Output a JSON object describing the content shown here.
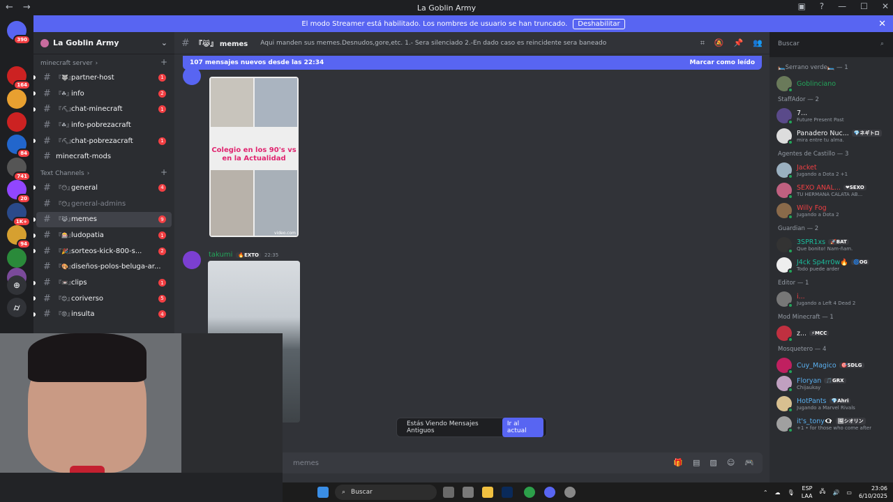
{
  "window": {
    "title": "La Goblin Army"
  },
  "servers": [
    {
      "badge": "390",
      "color": "#5865f2"
    },
    {
      "badge": "164",
      "color": "#c22"
    },
    {
      "badge": "",
      "color": "#e8a030"
    },
    {
      "badge": "",
      "color": "#c22"
    },
    {
      "badge": "84",
      "color": "#2266cc"
    },
    {
      "badge": "741",
      "color": "#555"
    },
    {
      "badge": "20",
      "color": "#9146ff"
    },
    {
      "badge": "1K+",
      "color": "#2a4a8a"
    },
    {
      "badge": "94",
      "color": "#d6a030"
    },
    {
      "badge": "",
      "color": "#2a8a3a"
    },
    {
      "badge": "",
      "color": "#7a4a9a"
    }
  ],
  "banner": {
    "text": "El modo Streamer está habilitado. Los nombres de usuario se han truncado.",
    "button": "Deshabilitar"
  },
  "guild": {
    "name": "La Goblin Army"
  },
  "categories": [
    {
      "label": "minecraft server",
      "channels": [
        {
          "name": "partner-host",
          "emoji": "『🐺』",
          "badge": "1",
          "muted": false
        },
        {
          "name": "info",
          "emoji": "『☘』",
          "badge": "2",
          "muted": false
        },
        {
          "name": "chat-minecraft",
          "emoji": "『⛏』",
          "badge": "1",
          "muted": false
        },
        {
          "name": "info-pobrezacraft",
          "emoji": "『☘』",
          "badge": "",
          "muted": false
        },
        {
          "name": "chat-pobrezacraft",
          "emoji": "『⛏』",
          "badge": "1",
          "muted": false
        },
        {
          "name": "minecraft-mods",
          "emoji": "",
          "badge": "",
          "muted": false
        }
      ]
    },
    {
      "label": "Text Channels",
      "channels": [
        {
          "name": "general",
          "emoji": "『😶』",
          "badge": "4",
          "muted": false
        },
        {
          "name": "general-admins",
          "emoji": "『😶』",
          "badge": "",
          "muted": true
        },
        {
          "name": "memes",
          "emoji": "『😹』",
          "badge": "9",
          "muted": false,
          "active": true
        },
        {
          "name": "ludopatia",
          "emoji": "『🎰』",
          "badge": "1",
          "muted": false
        },
        {
          "name": "sorteos-kick-800-s...",
          "emoji": "『🎉』",
          "badge": "2",
          "muted": false
        },
        {
          "name": "diseños-polos-beluga-ar...",
          "emoji": "『🎨』",
          "badge": "",
          "muted": false
        },
        {
          "name": "clips",
          "emoji": "『📼』",
          "badge": "1",
          "muted": false
        },
        {
          "name": "coriverso",
          "emoji": "『😊』",
          "badge": "5",
          "muted": false
        },
        {
          "name": "insulta",
          "emoji": "『😡』",
          "badge": "4",
          "muted": false
        }
      ]
    }
  ],
  "channel": {
    "name": "memes",
    "emoji": "『😹』",
    "topic": "Aqui manden sus memes.Desnudos,gore,etc. 1.- Sera silenciado 2.-En dado caso es reincidente sera baneado"
  },
  "new_messages": {
    "text": "107 mensajes nuevos desde las 22:34",
    "mark": "Marcar como leído"
  },
  "messages": [
    {
      "image_caption": "Colegio en los 90's vs en la Actualidad",
      "watermark": "video.com"
    },
    {
      "author": "takumi",
      "tag": "🔥EXTO",
      "time": "22:35"
    }
  ],
  "old_messages": {
    "text": "Estás Viendo Mensajes Antiguos",
    "button": "Ir al actual"
  },
  "composer": {
    "placeholder": "memes"
  },
  "members_search": {
    "placeholder": "Buscar"
  },
  "member_groups": [
    {
      "label": "🛏️Serrano verde🛏️ — 1",
      "members": [
        {
          "name": "Goblinciano",
          "color": "#23a55a",
          "activity": "",
          "tag": ""
        }
      ]
    },
    {
      "label": "StaffAdor — 2",
      "members": [
        {
          "name": "7...",
          "color": "#f2f3f5",
          "activity": "Future Present Past",
          "tag": ""
        },
        {
          "name": "Panadero Nuc...",
          "color": "#f2f3f5",
          "activity": "mira entre tu alma.",
          "tag": "💎ネギトロ"
        }
      ]
    },
    {
      "label": "Agentes de Castillo — 3",
      "members": [
        {
          "name": "Jacket",
          "color": "#f23f43",
          "activity": "Jugando a Dota 2 +1",
          "tag": ""
        },
        {
          "name": "SEXO ANAL...",
          "color": "#f23f43",
          "activity": "TU HERMANA CALATA AB...",
          "tag": "❤SEXO"
        },
        {
          "name": "Willy Fog",
          "color": "#f23f43",
          "activity": "Jugando a Dota 2",
          "tag": ""
        }
      ]
    },
    {
      "label": "Guardian — 2",
      "members": [
        {
          "name": "3SPR1xs",
          "color": "#1abc9c",
          "activity": "Que bonito! Ñam-ñam.",
          "tag": "🚀BAT"
        },
        {
          "name": "J4ck Sp4rr0w🔥",
          "color": "#1abc9c",
          "activity": "Todo puede arder",
          "tag": "🌀OG"
        }
      ]
    },
    {
      "label": "Editor — 1",
      "members": [
        {
          "name": "i...",
          "color": "#f23f43",
          "activity": "Jugando a Left 4 Dead 2",
          "tag": ""
        }
      ]
    },
    {
      "label": "Mod Minecraft — 1",
      "members": [
        {
          "name": "z...",
          "color": "#f2f3f5",
          "activity": "",
          "tag": "⚡MCC"
        }
      ]
    },
    {
      "label": "Mosquetero — 4",
      "members": [
        {
          "name": "Cuy_Magico",
          "color": "#5ab0f0",
          "activity": "",
          "tag": "🎯SDLG"
        },
        {
          "name": "Floryan",
          "color": "#5ab0f0",
          "activity": "Chijaukay",
          "tag": "🎵GRX"
        },
        {
          "name": "HotPants",
          "color": "#5ab0f0",
          "activity": "Jugando a Marvel Rivals",
          "tag": "💎Ahri"
        },
        {
          "name": "it's_tony👁‍🗨",
          "color": "#5ab0f0",
          "activity": "+1 • for those who come after",
          "tag": "🖼シオリン"
        }
      ]
    }
  ],
  "taskbar": {
    "search": "Buscar",
    "lang1": "ESP",
    "lang2": "LAA",
    "time": "23:06",
    "date": "6/10/2025"
  }
}
